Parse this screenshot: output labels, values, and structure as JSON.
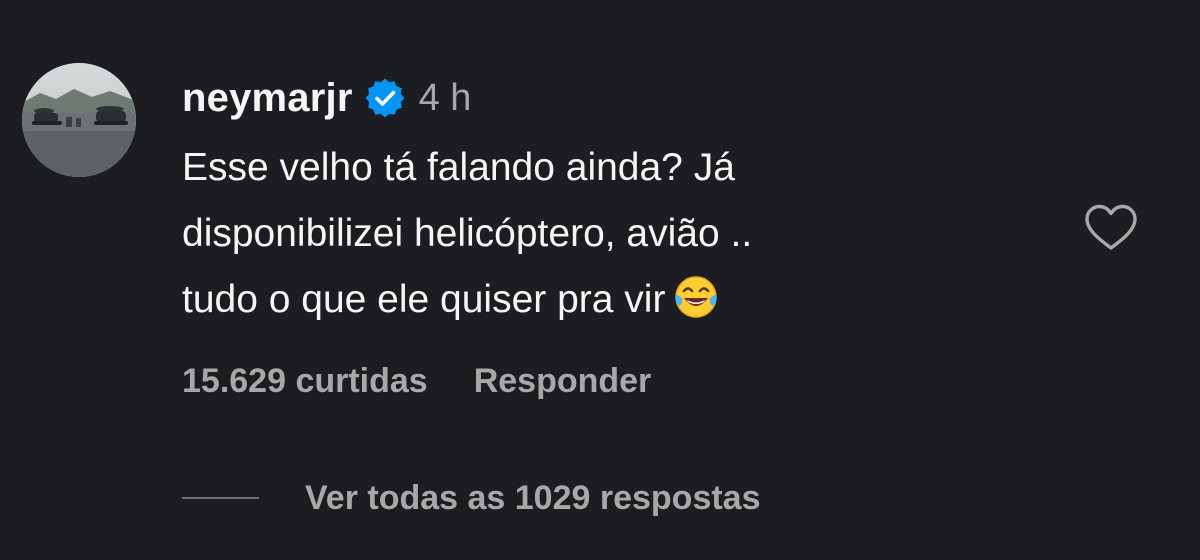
{
  "comment": {
    "username": "neymarjr",
    "verified_icon": "verified-badge-icon",
    "time": "4 h",
    "text_lines": [
      "Esse velho tá falando ainda? Já",
      "disponibilizei helicóptero, avião ..",
      "tudo o que ele quiser pra vir"
    ],
    "emoji": "face-with-tears-of-joy",
    "likes": "15.629 curtidas",
    "reply_label": "Responder",
    "view_replies_label": "Ver todas as 1029 respostas",
    "like_icon": "heart-outline-icon"
  },
  "colors": {
    "background": "#1c1d21",
    "primary_text": "#f5f5f5",
    "secondary_text": "#a8a8a8",
    "verified_blue": "#0095f6"
  }
}
